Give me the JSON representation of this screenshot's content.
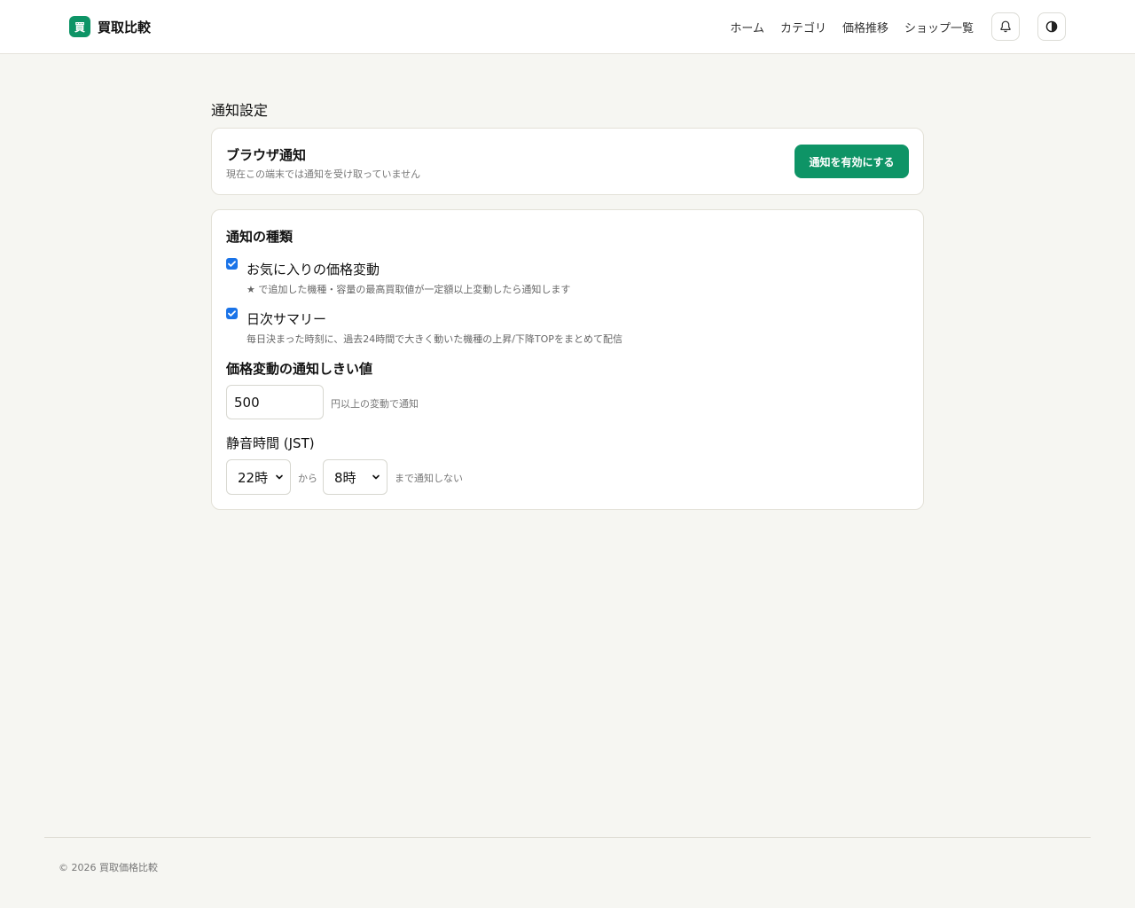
{
  "header": {
    "logo_char": "買",
    "brand": "買取比較",
    "nav": [
      "ホーム",
      "カテゴリ",
      "価格推移",
      "ショップ一覧"
    ],
    "icons": {
      "notifications": "bell-icon",
      "theme": "contrast-icon"
    }
  },
  "page": {
    "title": "通知設定"
  },
  "browser_card": {
    "title": "ブラウザ通知",
    "subtitle": "現在この端末では通知を受け取っていません",
    "enable_button": "通知を有効にする"
  },
  "types_card": {
    "title": "通知の種類",
    "options": [
      {
        "label": "お気に入りの価格変動",
        "description": "★ で追加した機種・容量の最高買取値が一定額以上変動したら通知します",
        "checked": true
      },
      {
        "label": "日次サマリー",
        "description": "毎日決まった時刻に、過去24時間で大きく動いた機種の上昇/下降TOPをまとめて配信",
        "checked": true
      }
    ],
    "threshold": {
      "label": "価格変動の通知しきい値",
      "value": "500",
      "suffix": "円以上の変動で通知"
    },
    "quiet_hours": {
      "label": "静音時間 (JST)",
      "start": "22時",
      "from_text": "から",
      "end": "8時",
      "until_text": "まで通知しない"
    }
  },
  "footer": {
    "copyright": "© 2026 買取価格比較"
  },
  "colors": {
    "accent": "#0e9466",
    "background": "#f6f6f2",
    "checkbox": "#1a73e8"
  }
}
